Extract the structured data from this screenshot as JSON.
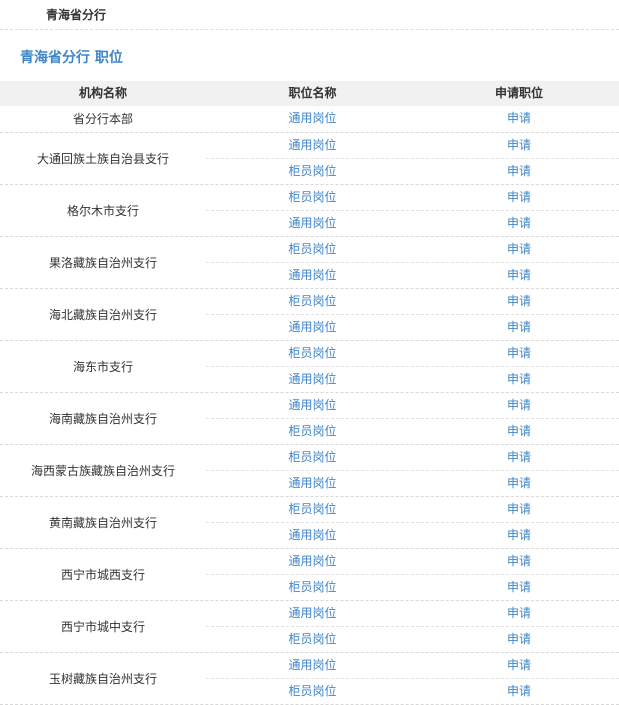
{
  "header": {
    "title": "青海省分行"
  },
  "section": {
    "title": "青海省分行 职位"
  },
  "table": {
    "columns": [
      "机构名称",
      "职位名称",
      "申请职位"
    ],
    "groups": [
      {
        "org": "省分行本部",
        "positions": [
          {
            "name": "通用岗位",
            "apply": "申请"
          }
        ]
      },
      {
        "org": "大通回族土族自治县支行",
        "positions": [
          {
            "name": "通用岗位",
            "apply": "申请"
          },
          {
            "name": "柜员岗位",
            "apply": "申请"
          }
        ]
      },
      {
        "org": "格尔木市支行",
        "positions": [
          {
            "name": "柜员岗位",
            "apply": "申请"
          },
          {
            "name": "通用岗位",
            "apply": "申请"
          }
        ]
      },
      {
        "org": "果洛藏族自治州支行",
        "positions": [
          {
            "name": "柜员岗位",
            "apply": "申请"
          },
          {
            "name": "通用岗位",
            "apply": "申请"
          }
        ]
      },
      {
        "org": "海北藏族自治州支行",
        "positions": [
          {
            "name": "柜员岗位",
            "apply": "申请"
          },
          {
            "name": "通用岗位",
            "apply": "申请"
          }
        ]
      },
      {
        "org": "海东市支行",
        "positions": [
          {
            "name": "柜员岗位",
            "apply": "申请"
          },
          {
            "name": "通用岗位",
            "apply": "申请"
          }
        ]
      },
      {
        "org": "海南藏族自治州支行",
        "positions": [
          {
            "name": "通用岗位",
            "apply": "申请"
          },
          {
            "name": "柜员岗位",
            "apply": "申请"
          }
        ]
      },
      {
        "org": "海西蒙古族藏族自治州支行",
        "positions": [
          {
            "name": "柜员岗位",
            "apply": "申请"
          },
          {
            "name": "通用岗位",
            "apply": "申请"
          }
        ]
      },
      {
        "org": "黄南藏族自治州支行",
        "positions": [
          {
            "name": "柜员岗位",
            "apply": "申请"
          },
          {
            "name": "通用岗位",
            "apply": "申请"
          }
        ]
      },
      {
        "org": "西宁市城西支行",
        "positions": [
          {
            "name": "通用岗位",
            "apply": "申请"
          },
          {
            "name": "柜员岗位",
            "apply": "申请"
          }
        ]
      },
      {
        "org": "西宁市城中支行",
        "positions": [
          {
            "name": "通用岗位",
            "apply": "申请"
          },
          {
            "name": "柜员岗位",
            "apply": "申请"
          }
        ]
      },
      {
        "org": "玉树藏族自治州支行",
        "positions": [
          {
            "name": "通用岗位",
            "apply": "申请"
          },
          {
            "name": "柜员岗位",
            "apply": "申请"
          }
        ]
      }
    ]
  },
  "colors": {
    "link": "#3f86c9",
    "header_bg": "#f1f1f1",
    "text": "#333333"
  }
}
